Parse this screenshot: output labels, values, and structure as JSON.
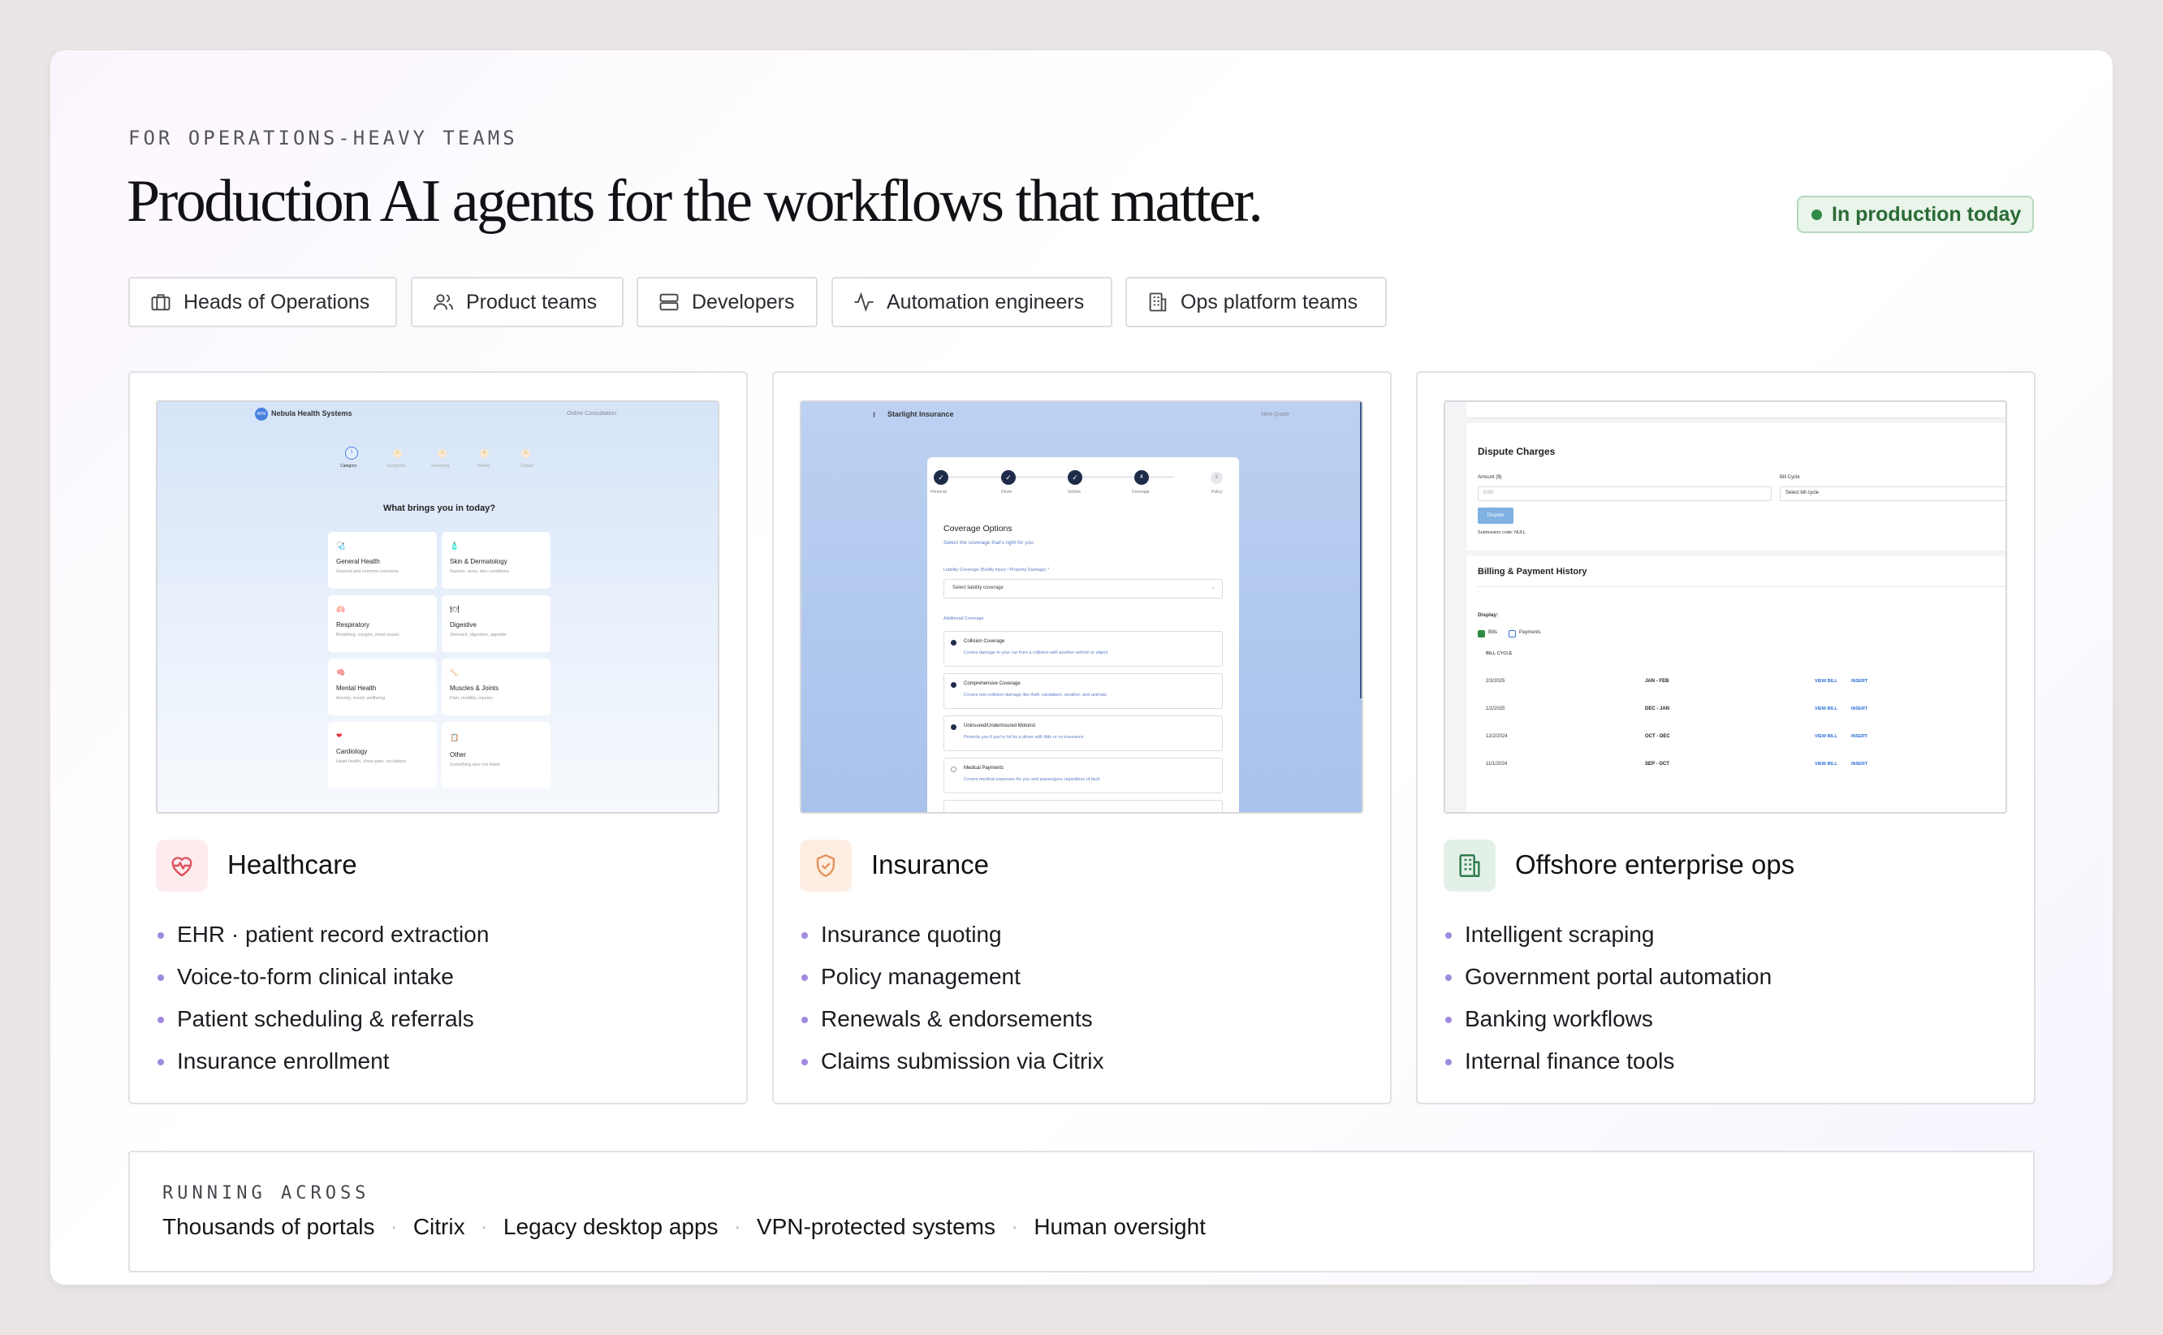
{
  "eyebrow": "FOR OPERATIONS-HEAVY TEAMS",
  "headline": "Production AI agents for the workflows that matter.",
  "status_badge": {
    "label": "In production today",
    "color": "#2f8a44"
  },
  "audiences": [
    {
      "label": "Heads of Operations",
      "icon": "briefcase-icon"
    },
    {
      "label": "Product teams",
      "icon": "users-icon"
    },
    {
      "label": "Developers",
      "icon": "server-icon"
    },
    {
      "label": "Automation engineers",
      "icon": "activity-icon"
    },
    {
      "label": "Ops platform teams",
      "icon": "building-icon"
    }
  ],
  "cards": [
    {
      "title": "Healthcare",
      "icon": "heart-pulse-icon",
      "icon_color": "#e0505c",
      "bullets": [
        "EHR · patient record extraction",
        "Voice-to-form clinical intake",
        "Patient scheduling & referrals",
        "Insurance enrollment"
      ],
      "screenshot": {
        "brand": "Nebula Health Systems",
        "brand_badge": "NHS",
        "nav_right": "Online Consultation",
        "steps": [
          "Category",
          "Symptoms",
          "Screening",
          "Details",
          "Contact"
        ],
        "step_numbers": [
          "1",
          "2",
          "3",
          "4",
          "5"
        ],
        "question": "What brings you in today?",
        "options": [
          {
            "title": "General Health",
            "desc": "General and common concerns"
          },
          {
            "title": "Skin & Dermatology",
            "desc": "Rashes, acne, skin conditions"
          },
          {
            "title": "Respiratory",
            "desc": "Breathing, coughs, chest issues"
          },
          {
            "title": "Digestive",
            "desc": "Stomach, digestion, appetite"
          },
          {
            "title": "Mental Health",
            "desc": "Anxiety, mood, wellbeing"
          },
          {
            "title": "Muscles & Joints",
            "desc": "Pain, mobility, injuries"
          },
          {
            "title": "Cardiology",
            "desc": "Heart health, chest pain, circulation"
          },
          {
            "title": "Other",
            "desc": "Something else not listed"
          }
        ]
      }
    },
    {
      "title": "Insurance",
      "icon": "shield-check-icon",
      "icon_color": "#e8925a",
      "bullets": [
        "Insurance quoting",
        "Policy management",
        "Renewals & endorsements",
        "Claims submission via Citrix"
      ],
      "screenshot": {
        "brand": "Starlight Insurance",
        "nav_right": "New Quote",
        "steps": [
          "Personal",
          "Driver",
          "Vehicle",
          "Coverage",
          "Policy"
        ],
        "step_numbers": [
          "4",
          "5"
        ],
        "heading": "Coverage Options",
        "subheading": "Select the coverage that's right for you",
        "liability_label": "Liability Coverage (Bodily Injury / Property Damage) *",
        "liability_placeholder": "Select liability coverage",
        "additional_label": "Additional Coverage",
        "options": [
          {
            "title": "Collision Coverage",
            "desc": "Covers damage to your car from a collision with another vehicle or object",
            "checked": true
          },
          {
            "title": "Comprehensive Coverage",
            "desc": "Covers non-collision damage like theft, vandalism, weather, and animals",
            "checked": true
          },
          {
            "title": "Uninsured/Underinsured Motorist",
            "desc": "Protects you if you're hit by a driver with little or no insurance",
            "checked": true
          },
          {
            "title": "Medical Payments",
            "desc": "Covers medical expenses for you and passengers regardless of fault",
            "checked": false
          }
        ]
      }
    },
    {
      "title": "Offshore enterprise ops",
      "icon": "office-building-icon",
      "icon_color": "#2f7a4c",
      "bullets": [
        "Intelligent scraping",
        "Government portal automation",
        "Banking workflows",
        "Internal finance tools"
      ],
      "screenshot": {
        "dispute_title": "Dispute Charges",
        "amount_label": "Amount ($)",
        "amount_placeholder": "0.00",
        "cycle_label": "Bill Cycle",
        "cycle_placeholder": "Select bill cycle",
        "dispute_button": "Dispute",
        "submission_code": "Submission code: NULL",
        "history_title": "Billing & Payment History",
        "display_label": "Display:",
        "filter_bills": "Bills",
        "filter_payments": "Payments",
        "column_header": "BILL CYCLE",
        "view_label": "VIEW BILL",
        "insert_label": "INSERT",
        "rows": [
          {
            "date": "2/3/2025",
            "cycle": "JAN - FEB"
          },
          {
            "date": "1/2/2025",
            "cycle": "DEC - JAN"
          },
          {
            "date": "12/2/2024",
            "cycle": "OCT - DEC"
          },
          {
            "date": "11/1/2024",
            "cycle": "SEP - OCT"
          }
        ]
      }
    }
  ],
  "running_across": {
    "label": "RUNNING ACROSS",
    "items": [
      "Thousands of portals",
      "Citrix",
      "Legacy desktop apps",
      "VPN-protected systems",
      "Human oversight"
    ],
    "separator": "·"
  }
}
